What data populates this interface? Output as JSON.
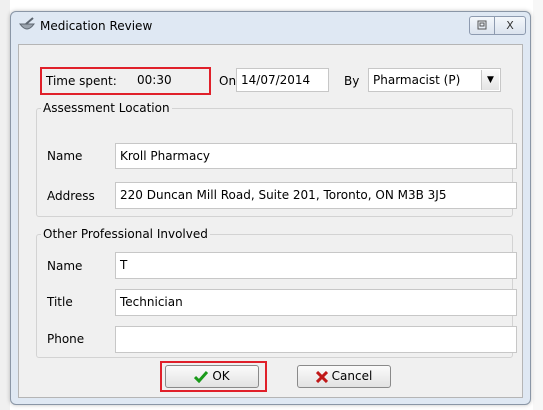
{
  "window": {
    "title": "Medication Review",
    "restore_icon": "restore-icon",
    "close_glyph": "X"
  },
  "time": {
    "label": "Time spent:",
    "value": "00:30",
    "on_label": "On",
    "date": "14/07/2014",
    "by_label": "By",
    "by_value": "Pharmacist (P)"
  },
  "assessment": {
    "title": "Assessment Location",
    "name_label": "Name",
    "name_value": "Kroll Pharmacy",
    "address_label": "Address",
    "address_value": "220 Duncan Mill Road, Suite 201, Toronto, ON M3B 3J5"
  },
  "other": {
    "title": "Other Professional Involved",
    "name_label": "Name",
    "name_value": "T",
    "title_label": "Title",
    "title_value": "Technician",
    "phone_label": "Phone",
    "phone_value": ""
  },
  "buttons": {
    "ok": "OK",
    "cancel": "Cancel"
  },
  "colors": {
    "highlight": "#e0202a",
    "ok_check": "#1a9a1a",
    "cancel_x": "#c01818"
  }
}
